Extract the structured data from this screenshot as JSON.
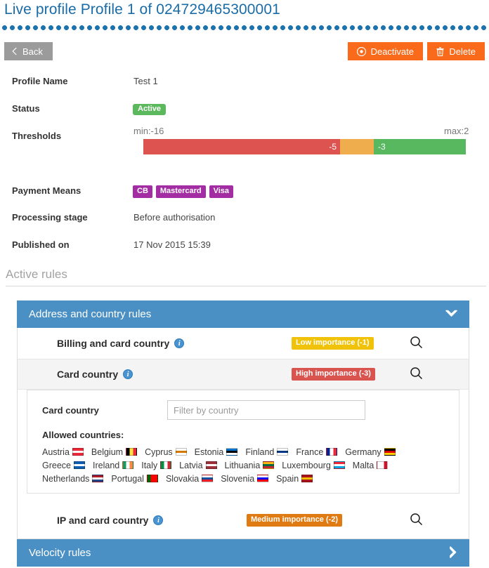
{
  "header": {
    "title": "Live profile Profile 1 of 024729465300001"
  },
  "toolbar": {
    "back_label": "Back",
    "back_icon": "chevron-left-icon",
    "deactivate_label": "Deactivate",
    "deactivate_icon": "deactivate-circle-icon",
    "delete_label": "Delete",
    "delete_icon": "trash-icon",
    "back_color": "#9b9b9b",
    "action_color": "#f96a1b"
  },
  "details": {
    "profile_name_label": "Profile Name",
    "profile_name_value": "Test 1",
    "status_label": "Status",
    "status_value": "Active",
    "status_color": "#5cb85c",
    "thresholds_label": "Thresholds",
    "thresholds": {
      "min_text": "min:-16",
      "max_text": "max:2",
      "min": -16,
      "max": 2,
      "segments": [
        {
          "label": "-5",
          "color": "#dd5350",
          "value": -5
        },
        {
          "label": "",
          "color": "#f0ad4e",
          "value": -3
        },
        {
          "label": "-3",
          "color": "#57b860",
          "value": 2
        }
      ]
    },
    "payment_means_label": "Payment Means",
    "payment_means": [
      "CB",
      "Mastercard",
      "Visa"
    ],
    "payment_means_color": "#a32ea3",
    "processing_stage_label": "Processing stage",
    "processing_stage_value": "Before authorisation",
    "published_on_label": "Published on",
    "published_on_value": "17 Nov 2015 15:39"
  },
  "active_rules": {
    "section_title": "Active rules",
    "panels": [
      {
        "title": "Address and country rules",
        "expanded": true,
        "chevron": "chevron-down-icon"
      },
      {
        "title": "Velocity rules",
        "expanded": false,
        "chevron": "chevron-right-icon"
      }
    ],
    "rules": [
      {
        "name": "Billing and card country",
        "info_icon": "info-icon",
        "importance_label": "Low importance (-1)",
        "importance_color": "#f0c30a",
        "search_icon": "search-icon"
      },
      {
        "name": "Card country",
        "info_icon": "info-icon",
        "importance_label": "High importance (-3)",
        "importance_color": "#d9534f",
        "search_icon": "search-icon"
      },
      {
        "name": "IP and card country",
        "info_icon": "info-icon",
        "importance_label": "Medium importance (-2)",
        "importance_color": "#e07b14",
        "search_icon": "search-icon"
      }
    ],
    "card_country_filter": {
      "label": "Card country",
      "placeholder": "Filter by country",
      "value": "",
      "allowed_label": "Allowed countries:",
      "countries": [
        {
          "name": "Austria",
          "colors": [
            "#ed2939",
            "#ffffff",
            "#ed2939"
          ],
          "dir": "h"
        },
        {
          "name": "Belgium",
          "colors": [
            "#000000",
            "#fae042",
            "#ed2939"
          ],
          "dir": "v"
        },
        {
          "name": "Cyprus",
          "colors": [
            "#ffffff",
            "#d57800",
            "#ffffff"
          ],
          "dir": "h"
        },
        {
          "name": "Estonia",
          "colors": [
            "#0072ce",
            "#000000",
            "#ffffff"
          ],
          "dir": "h"
        },
        {
          "name": "Finland",
          "colors": [
            "#ffffff",
            "#003580",
            "#ffffff"
          ],
          "dir": "h"
        },
        {
          "name": "France",
          "colors": [
            "#002395",
            "#ffffff",
            "#ed2939"
          ],
          "dir": "v"
        },
        {
          "name": "Germany",
          "colors": [
            "#000000",
            "#dd0000",
            "#ffce00"
          ],
          "dir": "h"
        },
        {
          "name": "Greece",
          "colors": [
            "#0d5eaf",
            "#ffffff",
            "#0d5eaf"
          ],
          "dir": "h"
        },
        {
          "name": "Ireland",
          "colors": [
            "#169b62",
            "#ffffff",
            "#ff883e"
          ],
          "dir": "v"
        },
        {
          "name": "Italy",
          "colors": [
            "#009246",
            "#ffffff",
            "#ce2b37"
          ],
          "dir": "v"
        },
        {
          "name": "Latvia",
          "colors": [
            "#9e3039",
            "#ffffff",
            "#9e3039"
          ],
          "dir": "h"
        },
        {
          "name": "Lithuania",
          "colors": [
            "#fdb913",
            "#006a44",
            "#c1272d"
          ],
          "dir": "h"
        },
        {
          "name": "Luxembourg",
          "colors": [
            "#ed2939",
            "#ffffff",
            "#00a1de"
          ],
          "dir": "h"
        },
        {
          "name": "Malta",
          "colors": [
            "#ffffff",
            "#ffffff",
            "#cf142b"
          ],
          "dir": "v"
        },
        {
          "name": "Netherlands",
          "colors": [
            "#ae1c28",
            "#ffffff",
            "#21468b"
          ],
          "dir": "h"
        },
        {
          "name": "Portugal",
          "colors": [
            "#006600",
            "#ff0000",
            "#ff0000"
          ],
          "dir": "v"
        },
        {
          "name": "Slovakia",
          "colors": [
            "#ffffff",
            "#0b4ea2",
            "#ee1c25"
          ],
          "dir": "h"
        },
        {
          "name": "Slovenia",
          "colors": [
            "#ffffff",
            "#0000ff",
            "#ff0000"
          ],
          "dir": "h"
        },
        {
          "name": "Spain",
          "colors": [
            "#aa151b",
            "#f1bf00",
            "#aa151b"
          ],
          "dir": "h"
        }
      ]
    }
  }
}
